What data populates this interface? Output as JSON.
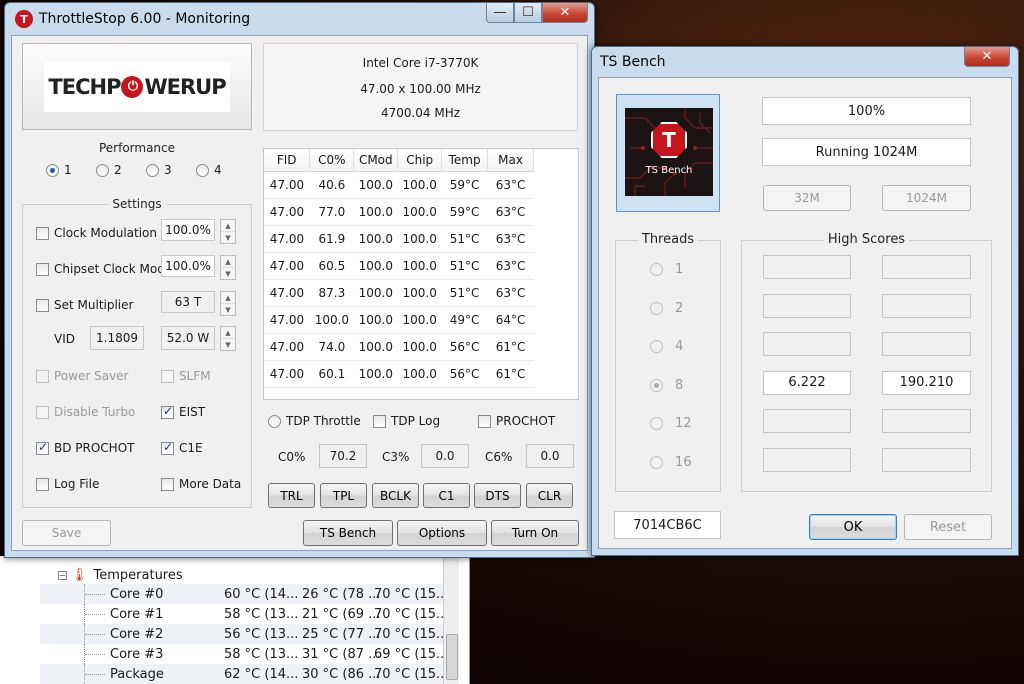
{
  "hwmon": {
    "group_label": "Temperatures",
    "rows": [
      {
        "name": "Core #0",
        "v1": "60 °C  (14...",
        "v2": "26 °C  (78 ...",
        "v3": "70 °C  (15..."
      },
      {
        "name": "Core #1",
        "v1": "58 °C  (13...",
        "v2": "21 °C  (69 ...",
        "v3": "70 °C  (15..."
      },
      {
        "name": "Core #2",
        "v1": "56 °C  (13...",
        "v2": "25 °C  (77 ...",
        "v3": "70 °C  (15..."
      },
      {
        "name": "Core #3",
        "v1": "58 °C  (13...",
        "v2": "31 °C  (87 ...",
        "v3": "69 °C  (15..."
      },
      {
        "name": "Package",
        "v1": "62 °C  (14...",
        "v2": "30 °C  (86 ...",
        "v3": "70 °C  (15..."
      }
    ]
  },
  "throttlestop": {
    "title": "ThrottleStop 6.00 - Monitoring",
    "logo_text_left": "TECHP",
    "logo_text_right": "WERUP",
    "cpu": {
      "name": "Intel Core i7-3770K",
      "multiplier": "47.00 x 100.00 MHz",
      "speed": "4700.04 MHz"
    },
    "performance": {
      "title": "Performance",
      "options": [
        "1",
        "2",
        "3",
        "4"
      ],
      "selected": "1"
    },
    "settings": {
      "title": "Settings",
      "clock_modulation": {
        "label": "Clock Modulation",
        "value": "100.0%"
      },
      "chipset_clock_mod": {
        "label": "Chipset Clock Mod",
        "value": "100.0%"
      },
      "set_multiplier": {
        "label": "Set Multiplier",
        "value": "63 T"
      },
      "vid": {
        "label": "VID",
        "value": "1.1809",
        "power": "52.0 W"
      },
      "power_saver": "Power Saver",
      "slfm": "SLFM",
      "disable_turbo": "Disable Turbo",
      "eist": "EIST",
      "bd_prochot": "BD PROCHOT",
      "c1e": "C1E",
      "log_file": "Log File",
      "more_data": "More Data"
    },
    "table": {
      "headers": [
        "FID",
        "C0%",
        "CMod",
        "Chip",
        "Temp",
        "Max"
      ],
      "rows": [
        [
          "47.00",
          "40.6",
          "100.0",
          "100.0",
          "59°C",
          "63°C"
        ],
        [
          "47.00",
          "77.0",
          "100.0",
          "100.0",
          "59°C",
          "63°C"
        ],
        [
          "47.00",
          "61.9",
          "100.0",
          "100.0",
          "51°C",
          "63°C"
        ],
        [
          "47.00",
          "60.5",
          "100.0",
          "100.0",
          "51°C",
          "63°C"
        ],
        [
          "47.00",
          "87.3",
          "100.0",
          "100.0",
          "51°C",
          "63°C"
        ],
        [
          "47.00",
          "100.0",
          "100.0",
          "100.0",
          "49°C",
          "64°C"
        ],
        [
          "47.00",
          "74.0",
          "100.0",
          "100.0",
          "56°C",
          "61°C"
        ],
        [
          "47.00",
          "60.1",
          "100.0",
          "100.0",
          "56°C",
          "61°C"
        ]
      ]
    },
    "tdp_throttle": "TDP Throttle",
    "tdp_log": "TDP Log",
    "prochot": "PROCHOT",
    "c0": {
      "label": "C0%",
      "value": "70.2"
    },
    "c3": {
      "label": "C3%",
      "value": "0.0"
    },
    "c6": {
      "label": "C6%",
      "value": "0.0"
    },
    "buttons": {
      "trl": "TRL",
      "tpl": "TPL",
      "bclk": "BCLK",
      "c1": "C1",
      "dts": "DTS",
      "clr": "CLR"
    },
    "save": "Save",
    "ts_bench": "TS Bench",
    "options": "Options",
    "turn_on": "Turn On"
  },
  "tsbench": {
    "title": "TS Bench",
    "logo_caption": "TS Bench",
    "progress": "100%",
    "status": "Running 1024M",
    "size_32m": "32M",
    "size_1024m": "1024M",
    "threads_title": "Threads",
    "threads": [
      "1",
      "2",
      "4",
      "8",
      "12",
      "16"
    ],
    "selected_thread": "8",
    "high_scores_title": "High Scores",
    "scores": [
      [
        "",
        ""
      ],
      [
        "",
        ""
      ],
      [
        "",
        ""
      ],
      [
        "6.222",
        "190.210"
      ],
      [
        "",
        ""
      ],
      [
        "",
        ""
      ]
    ],
    "code": "7014CB6C",
    "ok": "OK",
    "reset": "Reset"
  }
}
